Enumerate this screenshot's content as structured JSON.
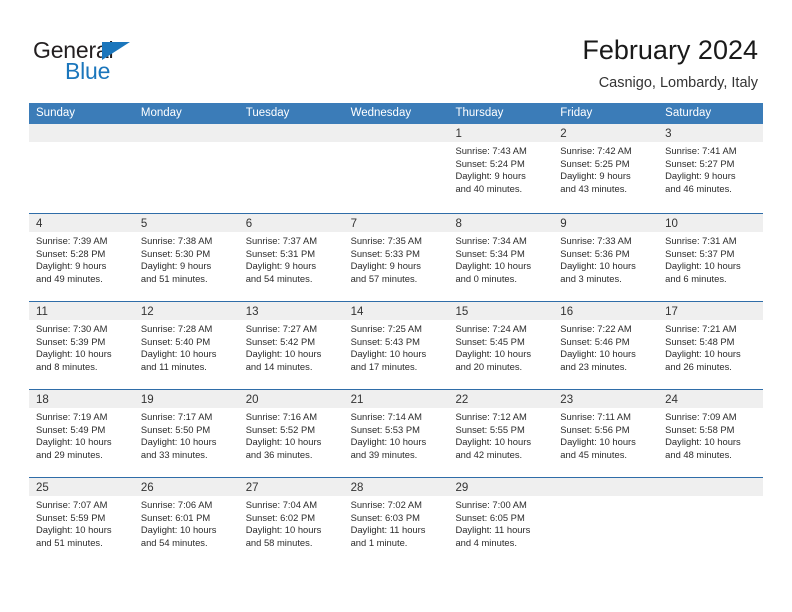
{
  "brand": {
    "name_top": "General",
    "name_bottom": "Blue",
    "triangle_icon": "triangle-icon",
    "accent_color": "#1b76bc"
  },
  "header": {
    "title": "February 2024",
    "subtitle": "Casnigo, Lombardy, Italy"
  },
  "calendar": {
    "header_bg": "#3b7cb8",
    "row_border_color": "#2f6da8",
    "day_strip_bg": "#efefef",
    "weekdays": [
      "Sunday",
      "Monday",
      "Tuesday",
      "Wednesday",
      "Thursday",
      "Friday",
      "Saturday"
    ],
    "weeks": [
      [
        {
          "day": "",
          "lines": []
        },
        {
          "day": "",
          "lines": []
        },
        {
          "day": "",
          "lines": []
        },
        {
          "day": "",
          "lines": []
        },
        {
          "day": "1",
          "lines": [
            "Sunrise: 7:43 AM",
            "Sunset: 5:24 PM",
            "Daylight: 9 hours",
            "and 40 minutes."
          ]
        },
        {
          "day": "2",
          "lines": [
            "Sunrise: 7:42 AM",
            "Sunset: 5:25 PM",
            "Daylight: 9 hours",
            "and 43 minutes."
          ]
        },
        {
          "day": "3",
          "lines": [
            "Sunrise: 7:41 AM",
            "Sunset: 5:27 PM",
            "Daylight: 9 hours",
            "and 46 minutes."
          ]
        }
      ],
      [
        {
          "day": "4",
          "lines": [
            "Sunrise: 7:39 AM",
            "Sunset: 5:28 PM",
            "Daylight: 9 hours",
            "and 49 minutes."
          ]
        },
        {
          "day": "5",
          "lines": [
            "Sunrise: 7:38 AM",
            "Sunset: 5:30 PM",
            "Daylight: 9 hours",
            "and 51 minutes."
          ]
        },
        {
          "day": "6",
          "lines": [
            "Sunrise: 7:37 AM",
            "Sunset: 5:31 PM",
            "Daylight: 9 hours",
            "and 54 minutes."
          ]
        },
        {
          "day": "7",
          "lines": [
            "Sunrise: 7:35 AM",
            "Sunset: 5:33 PM",
            "Daylight: 9 hours",
            "and 57 minutes."
          ]
        },
        {
          "day": "8",
          "lines": [
            "Sunrise: 7:34 AM",
            "Sunset: 5:34 PM",
            "Daylight: 10 hours",
            "and 0 minutes."
          ]
        },
        {
          "day": "9",
          "lines": [
            "Sunrise: 7:33 AM",
            "Sunset: 5:36 PM",
            "Daylight: 10 hours",
            "and 3 minutes."
          ]
        },
        {
          "day": "10",
          "lines": [
            "Sunrise: 7:31 AM",
            "Sunset: 5:37 PM",
            "Daylight: 10 hours",
            "and 6 minutes."
          ]
        }
      ],
      [
        {
          "day": "11",
          "lines": [
            "Sunrise: 7:30 AM",
            "Sunset: 5:39 PM",
            "Daylight: 10 hours",
            "and 8 minutes."
          ]
        },
        {
          "day": "12",
          "lines": [
            "Sunrise: 7:28 AM",
            "Sunset: 5:40 PM",
            "Daylight: 10 hours",
            "and 11 minutes."
          ]
        },
        {
          "day": "13",
          "lines": [
            "Sunrise: 7:27 AM",
            "Sunset: 5:42 PM",
            "Daylight: 10 hours",
            "and 14 minutes."
          ]
        },
        {
          "day": "14",
          "lines": [
            "Sunrise: 7:25 AM",
            "Sunset: 5:43 PM",
            "Daylight: 10 hours",
            "and 17 minutes."
          ]
        },
        {
          "day": "15",
          "lines": [
            "Sunrise: 7:24 AM",
            "Sunset: 5:45 PM",
            "Daylight: 10 hours",
            "and 20 minutes."
          ]
        },
        {
          "day": "16",
          "lines": [
            "Sunrise: 7:22 AM",
            "Sunset: 5:46 PM",
            "Daylight: 10 hours",
            "and 23 minutes."
          ]
        },
        {
          "day": "17",
          "lines": [
            "Sunrise: 7:21 AM",
            "Sunset: 5:48 PM",
            "Daylight: 10 hours",
            "and 26 minutes."
          ]
        }
      ],
      [
        {
          "day": "18",
          "lines": [
            "Sunrise: 7:19 AM",
            "Sunset: 5:49 PM",
            "Daylight: 10 hours",
            "and 29 minutes."
          ]
        },
        {
          "day": "19",
          "lines": [
            "Sunrise: 7:17 AM",
            "Sunset: 5:50 PM",
            "Daylight: 10 hours",
            "and 33 minutes."
          ]
        },
        {
          "day": "20",
          "lines": [
            "Sunrise: 7:16 AM",
            "Sunset: 5:52 PM",
            "Daylight: 10 hours",
            "and 36 minutes."
          ]
        },
        {
          "day": "21",
          "lines": [
            "Sunrise: 7:14 AM",
            "Sunset: 5:53 PM",
            "Daylight: 10 hours",
            "and 39 minutes."
          ]
        },
        {
          "day": "22",
          "lines": [
            "Sunrise: 7:12 AM",
            "Sunset: 5:55 PM",
            "Daylight: 10 hours",
            "and 42 minutes."
          ]
        },
        {
          "day": "23",
          "lines": [
            "Sunrise: 7:11 AM",
            "Sunset: 5:56 PM",
            "Daylight: 10 hours",
            "and 45 minutes."
          ]
        },
        {
          "day": "24",
          "lines": [
            "Sunrise: 7:09 AM",
            "Sunset: 5:58 PM",
            "Daylight: 10 hours",
            "and 48 minutes."
          ]
        }
      ],
      [
        {
          "day": "25",
          "lines": [
            "Sunrise: 7:07 AM",
            "Sunset: 5:59 PM",
            "Daylight: 10 hours",
            "and 51 minutes."
          ]
        },
        {
          "day": "26",
          "lines": [
            "Sunrise: 7:06 AM",
            "Sunset: 6:01 PM",
            "Daylight: 10 hours",
            "and 54 minutes."
          ]
        },
        {
          "day": "27",
          "lines": [
            "Sunrise: 7:04 AM",
            "Sunset: 6:02 PM",
            "Daylight: 10 hours",
            "and 58 minutes."
          ]
        },
        {
          "day": "28",
          "lines": [
            "Sunrise: 7:02 AM",
            "Sunset: 6:03 PM",
            "Daylight: 11 hours",
            "and 1 minute."
          ]
        },
        {
          "day": "29",
          "lines": [
            "Sunrise: 7:00 AM",
            "Sunset: 6:05 PM",
            "Daylight: 11 hours",
            "and 4 minutes."
          ]
        },
        {
          "day": "",
          "lines": []
        },
        {
          "day": "",
          "lines": []
        }
      ]
    ]
  }
}
